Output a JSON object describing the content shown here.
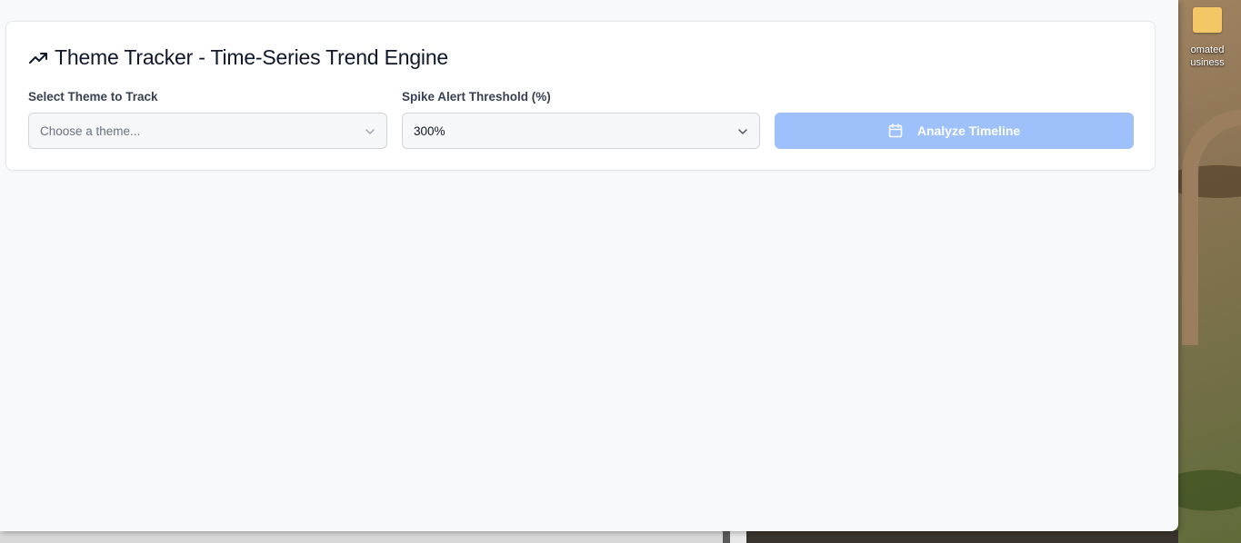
{
  "desktop": {
    "icon_label_line1": "omated",
    "icon_label_line2": "usiness"
  },
  "app": {
    "title": "Theme Tracker - Time-Series Trend Engine",
    "title_icon": "trending-up-icon",
    "theme_field": {
      "label": "Select Theme to Track",
      "placeholder": "Choose a theme...",
      "value": ""
    },
    "threshold_field": {
      "label": "Spike Alert Threshold (%)",
      "value": "300%"
    },
    "analyze_button": {
      "label": "Analyze Timeline",
      "icon": "calendar-icon",
      "state": "disabled"
    }
  },
  "colors": {
    "button_disabled": "#9ec1fb",
    "card_bg": "#ffffff",
    "page_bg": "#f8f9fb"
  }
}
